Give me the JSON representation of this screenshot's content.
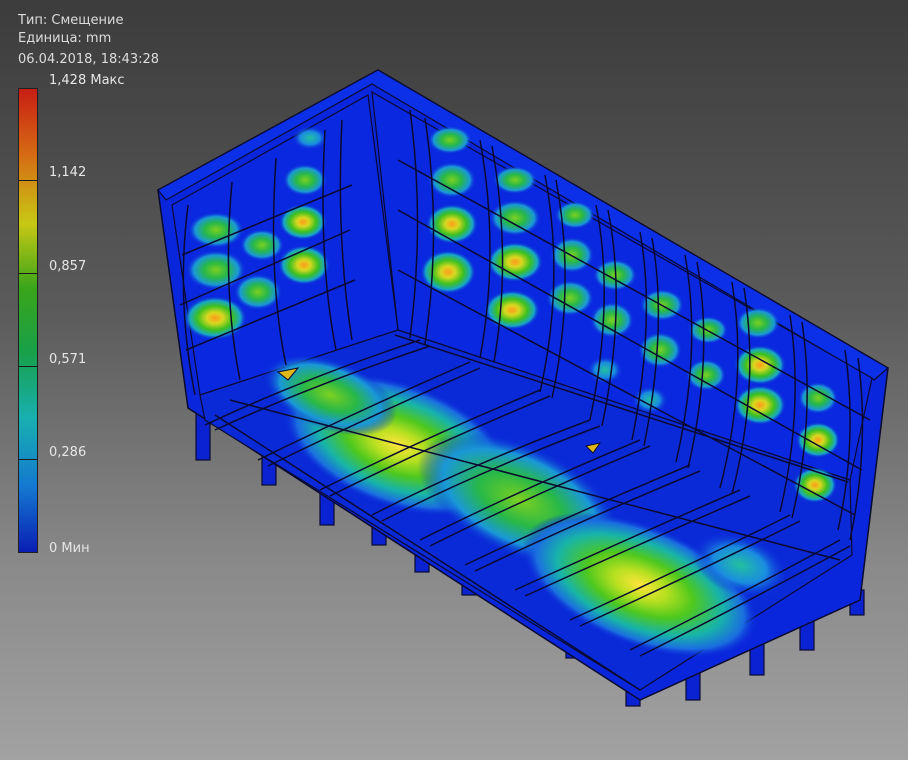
{
  "info": {
    "type_line": "Тип: Смещение",
    "units_line": "Единица: mm",
    "datetime_line": "06.04.2018, 18:43:28"
  },
  "legend": {
    "max_label": "1,428 Макс",
    "labels": [
      "1,142",
      "0,857",
      "0,571",
      "0,286"
    ],
    "min_label": "0 Мин",
    "colors": [
      "#c81e14",
      "#d66a14",
      "#c8c814",
      "#3aa51a",
      "#18a04a",
      "#18b0b0",
      "#1478d0",
      "#0a1eb4"
    ]
  }
}
